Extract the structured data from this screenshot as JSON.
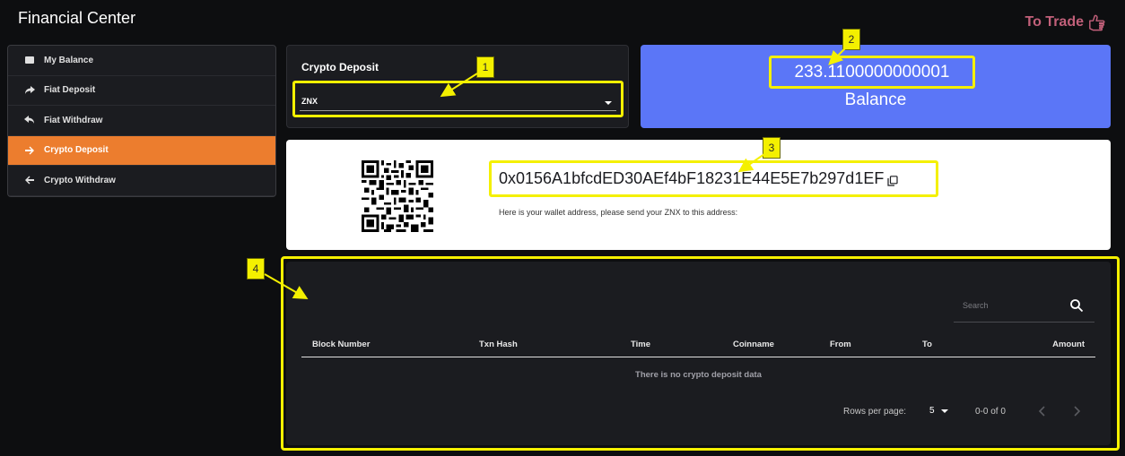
{
  "header": {
    "title": "Financial Center",
    "to_trade_label": "To Trade",
    "to_trade_color": "#c2607a"
  },
  "sidebar": {
    "active_color": "#ec7d2e",
    "items": [
      {
        "label": "My Balance",
        "icon": "wallet-icon"
      },
      {
        "label": "Fiat Deposit",
        "icon": "share-arrow-icon"
      },
      {
        "label": "Fiat Withdraw",
        "icon": "reply-arrow-icon"
      },
      {
        "label": "Crypto Deposit",
        "icon": "arrow-right-icon",
        "active": true
      },
      {
        "label": "Crypto Withdraw",
        "icon": "arrow-left-icon"
      }
    ]
  },
  "deposit": {
    "title": "Crypto Deposit",
    "selected_coin": "ZNX"
  },
  "balance": {
    "value": "233.1100000000001",
    "label": "Balance",
    "bg_color": "#5b76f7"
  },
  "wallet": {
    "address": "0x0156A1bfcdED30AEf4bF18231E44E5E7b297d1EF",
    "hint": "Here is your wallet address, please send your ZNX to this address:"
  },
  "table": {
    "search_placeholder": "Search",
    "columns": [
      "Block Number",
      "Txn Hash",
      "Time",
      "Coinname",
      "From",
      "To",
      "Amount"
    ],
    "rows": [],
    "empty_message": "There is no crypto deposit data",
    "rows_per_page_label": "Rows per page:",
    "rows_per_page": "5",
    "range_label": "0-0 of 0"
  },
  "annotations": {
    "badge_1": "1",
    "badge_2": "2",
    "badge_3": "3",
    "badge_4": "4",
    "highlight_color": "#f4f000"
  }
}
